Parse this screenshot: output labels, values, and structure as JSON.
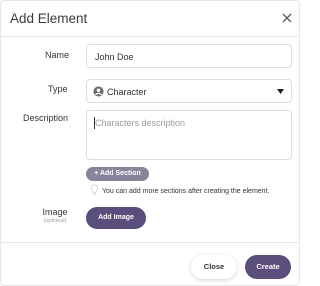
{
  "dialog": {
    "title": "Add Element",
    "close_icon": "close-icon"
  },
  "form": {
    "name": {
      "label": "Name",
      "value": "John Doe"
    },
    "type": {
      "label": "Type",
      "value": "Character",
      "icon": "person-icon"
    },
    "description": {
      "label": "Description",
      "value": "",
      "placeholder": "Characters description"
    },
    "add_section": {
      "label": "+ Add Section"
    },
    "hint": {
      "text": "You can add more sections after creating the element.",
      "icon": "lightbulb-icon"
    },
    "image": {
      "label": "Image",
      "sublabel": "(optional)",
      "button_label": "Add Image"
    }
  },
  "footer": {
    "close_label": "Close",
    "create_label": "Create"
  },
  "colors": {
    "primary": "#5a4e7d",
    "secondary": "#8a849a",
    "border": "#dcdcdc"
  }
}
